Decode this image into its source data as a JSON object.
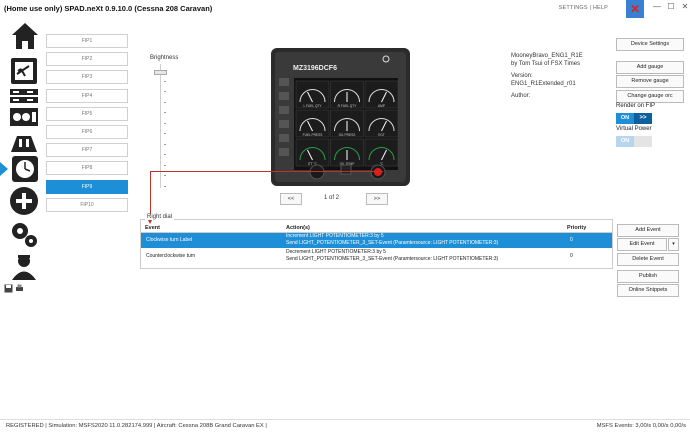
{
  "window": {
    "title": "(Home use only) SPAD.neXt 0.9.10.0 (Cessna 208 Caravan)",
    "links": "SETTINGS | HELP",
    "close_glyph": "✕",
    "minimize_glyph": "—",
    "maximize_glyph": "☐",
    "close_btn_glyph": "✕"
  },
  "sidebar": {
    "icons": [
      "home-icon",
      "airplane-panel-icon",
      "radio-stack-icon",
      "gauge-panel-icon",
      "switch-panel-icon",
      "fip-gauge-icon",
      "add-icon",
      "settings-gears-icon",
      "pilot-icon"
    ],
    "small_icons": [
      "save-icon",
      "print-icon"
    ]
  },
  "fip_list": [
    "FIP1",
    "FIP2",
    "FIP3",
    "FIP4",
    "FIP5",
    "FIP6",
    "FIP7",
    "FIP8",
    "FIP9",
    "FIP10"
  ],
  "fip_selected": "FIP9",
  "brightness": {
    "label": "Brightness",
    "level": 0.95
  },
  "device": {
    "serial": "MZ3196DCF6",
    "gauge_labels": [
      "L FUEL QTY",
      "R FUEL QTY",
      "AMP",
      "FUEL PRESS",
      "OIL PRESS",
      "EGT",
      "ITT °C",
      "OIL TEMP",
      "°C"
    ]
  },
  "pager": {
    "prev": "<<",
    "info": "1 of 2",
    "next": ">>"
  },
  "gauge_info": {
    "name": "MooneyBravo_ENG1_R1E",
    "author_line": "by Tom Tsui of FSX Times",
    "version_label": "Version:",
    "version": "ENG1_R1Extended_r01",
    "author_label": "Author:"
  },
  "right_panel": {
    "device_settings": "Device Settings",
    "add_gauge": "Add gauge",
    "remove_gauge": "Remove gauge",
    "change_gauge": "Change gauge orc",
    "render_label": "Render on FIP",
    "render_on": "ON",
    "render_arrows": ">>",
    "virtual_label": "Virtual Power",
    "virtual_on": "ON",
    "virtual_off": ""
  },
  "events": {
    "group_label": "Right dial",
    "headers": {
      "event": "Event",
      "actions": "Action(s)",
      "priority": "Priority"
    },
    "rows": [
      {
        "event": "Clockwise turn Label",
        "action1": "Increment LIGHT POTENTIOMETER:3 by 5",
        "action2": "Send LIGHT_POTENTIOMETER_3_SET-Event (Paramtersource: LIGHT POTENTIOMETER:3)",
        "priority": "0"
      },
      {
        "event": "Counterclockwise turn",
        "action1": "Decrement LIGHT POTENTIOMETER:3 by 5",
        "action2": "Send LIGHT_POTENTIOMETER_3_SET-Event (Paramtersource: LIGHT POTENTIOMETER:3)",
        "priority": "0"
      }
    ],
    "buttons": {
      "add": "Add Event",
      "edit": "Edit Event",
      "edit_dropdown": "▾",
      "delete": "Delete Event",
      "publish": "Publish",
      "snippets": "Online Snippets"
    }
  },
  "status": {
    "left": "REGISTERED     | Simulation: MSFS2020 11.0.282174.999   | Aircraft: Cessna 208B Grand Caravan EX   |",
    "right": "MSFS    Events: 3,00/s 0,00/s 0,00/s"
  },
  "colors": {
    "accent": "#1e8fd6",
    "arrow": "#c0312b",
    "close": "#d22"
  }
}
